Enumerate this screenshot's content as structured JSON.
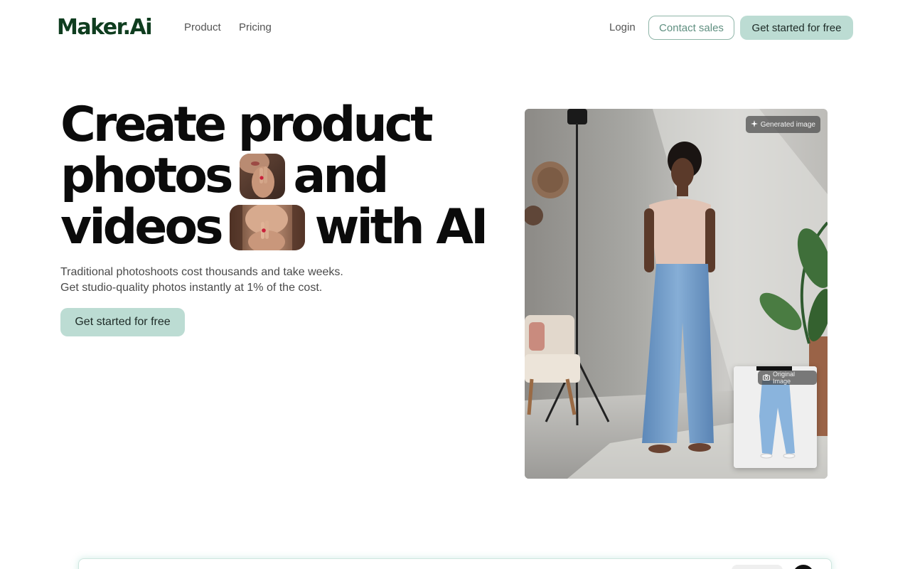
{
  "nav": {
    "logo": "Maker.Ai",
    "links": [
      "Product",
      "Pricing"
    ],
    "login": "Login",
    "contact_sales": "Contact sales",
    "get_started": "Get started for free"
  },
  "hero": {
    "headline": {
      "line1": "Create product",
      "line2a": "photos",
      "line2b": "and",
      "line3a": "videos",
      "line3b": "with AI"
    },
    "subtitle_line1": "Traditional photoshoots cost thousands and take weeks.",
    "subtitle_line2": "Get studio-quality photos instantly at 1% of the cost.",
    "cta": "Get started for free",
    "image": {
      "generated_badge": "Generated image",
      "original_badge": "Original Image"
    }
  },
  "colors": {
    "brand": "#0f3d1f",
    "accent": "#bcdcd3",
    "accent_border": "#8fb5a8"
  },
  "icons": {
    "generated": "sparkle-icon",
    "original": "camera-icon"
  }
}
